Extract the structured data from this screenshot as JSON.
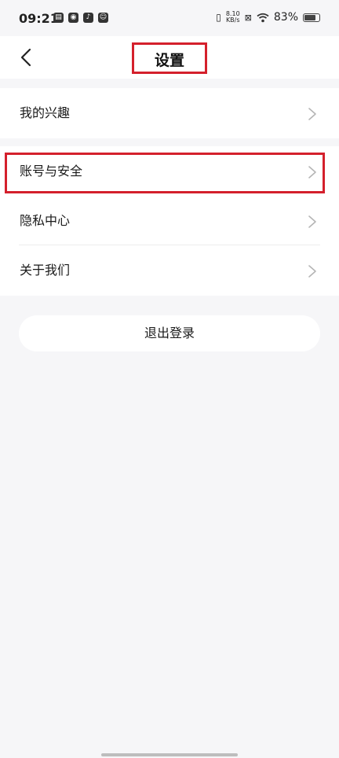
{
  "status_bar": {
    "time": "09:21",
    "net_speed_value": "8.10",
    "net_speed_unit": "KB/s",
    "battery_percent": "83%",
    "battery_level": 0.83
  },
  "header": {
    "title": "设置"
  },
  "menu": {
    "group1": [
      {
        "label": "我的兴趣"
      }
    ],
    "group2": [
      {
        "label": "账号与安全"
      },
      {
        "label": "隐私中心"
      },
      {
        "label": "关于我们"
      }
    ]
  },
  "logout": {
    "label": "退出登录"
  },
  "colors": {
    "highlight": "#d4202c",
    "background": "#f6f6f8"
  }
}
